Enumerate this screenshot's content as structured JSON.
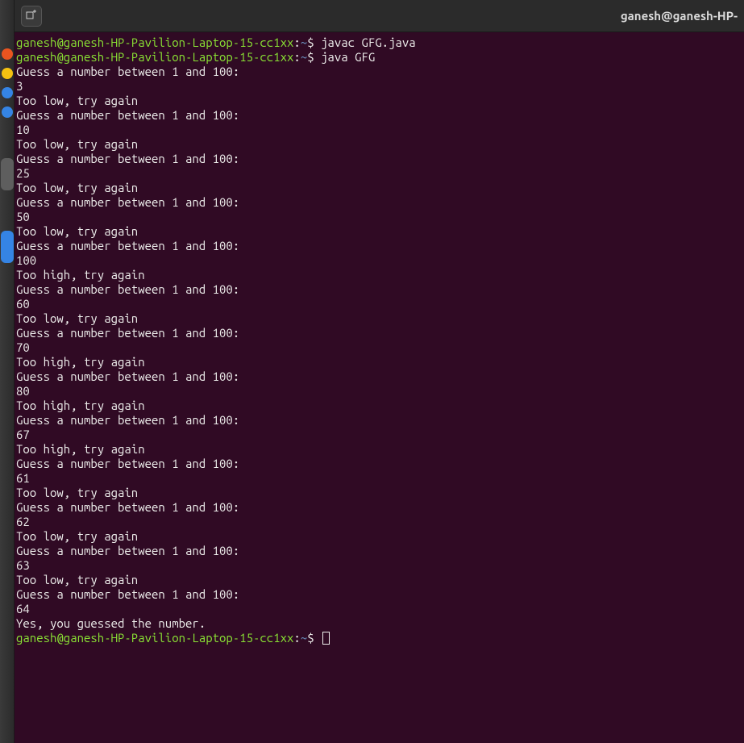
{
  "titlebar": {
    "title": "ganesh@ganesh-HP-"
  },
  "dock": {
    "items": [
      {
        "color": "#e95420"
      },
      {
        "color": "#f5c211"
      },
      {
        "color": "#3584e4"
      },
      {
        "color": "#3584e4"
      }
    ],
    "blobs": [
      {
        "color": "#5e5e5e"
      },
      {
        "color": "#3584e4"
      }
    ]
  },
  "prompt": {
    "user_host": "ganesh@ganesh-HP-Pavilion-Laptop-15-cc1xx",
    "separator": ":",
    "path": "~",
    "symbol": "$"
  },
  "session": [
    {
      "type": "cmd",
      "text": "javac GFG.java"
    },
    {
      "type": "cmd",
      "text": "java GFG"
    },
    {
      "type": "out",
      "text": "Guess a number between 1 and 100:"
    },
    {
      "type": "out",
      "text": "3"
    },
    {
      "type": "out",
      "text": "Too low, try again"
    },
    {
      "type": "out",
      "text": "Guess a number between 1 and 100:"
    },
    {
      "type": "out",
      "text": "10"
    },
    {
      "type": "out",
      "text": "Too low, try again"
    },
    {
      "type": "out",
      "text": "Guess a number between 1 and 100:"
    },
    {
      "type": "out",
      "text": "25"
    },
    {
      "type": "out",
      "text": "Too low, try again"
    },
    {
      "type": "out",
      "text": "Guess a number between 1 and 100:"
    },
    {
      "type": "out",
      "text": "50"
    },
    {
      "type": "out",
      "text": "Too low, try again"
    },
    {
      "type": "out",
      "text": "Guess a number between 1 and 100:"
    },
    {
      "type": "out",
      "text": "100"
    },
    {
      "type": "out",
      "text": "Too high, try again"
    },
    {
      "type": "out",
      "text": "Guess a number between 1 and 100:"
    },
    {
      "type": "out",
      "text": "60"
    },
    {
      "type": "out",
      "text": "Too low, try again"
    },
    {
      "type": "out",
      "text": "Guess a number between 1 and 100:"
    },
    {
      "type": "out",
      "text": "70"
    },
    {
      "type": "out",
      "text": "Too high, try again"
    },
    {
      "type": "out",
      "text": "Guess a number between 1 and 100:"
    },
    {
      "type": "out",
      "text": "80"
    },
    {
      "type": "out",
      "text": "Too high, try again"
    },
    {
      "type": "out",
      "text": "Guess a number between 1 and 100:"
    },
    {
      "type": "out",
      "text": "67"
    },
    {
      "type": "out",
      "text": "Too high, try again"
    },
    {
      "type": "out",
      "text": "Guess a number between 1 and 100:"
    },
    {
      "type": "out",
      "text": "61"
    },
    {
      "type": "out",
      "text": "Too low, try again"
    },
    {
      "type": "out",
      "text": "Guess a number between 1 and 100:"
    },
    {
      "type": "out",
      "text": "62"
    },
    {
      "type": "out",
      "text": "Too low, try again"
    },
    {
      "type": "out",
      "text": "Guess a number between 1 and 100:"
    },
    {
      "type": "out",
      "text": "63"
    },
    {
      "type": "out",
      "text": "Too low, try again"
    },
    {
      "type": "out",
      "text": "Guess a number between 1 and 100:"
    },
    {
      "type": "out",
      "text": "64"
    },
    {
      "type": "out",
      "text": "Yes, you guessed the number."
    },
    {
      "type": "prompt"
    }
  ]
}
